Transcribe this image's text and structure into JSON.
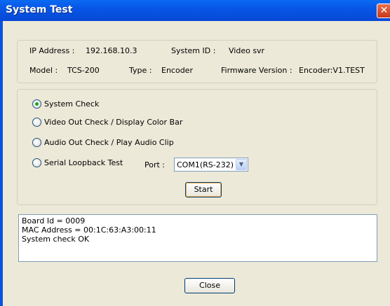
{
  "window": {
    "title": "System Test",
    "close_glyph": "✕"
  },
  "info": {
    "ip_label": "IP Address :",
    "ip_value": "192.168.10.3",
    "sysid_label": "System ID :",
    "sysid_value": "Video svr",
    "model_label": "Model :",
    "model_value": "TCS-200",
    "type_label": "Type :",
    "type_value": "Encoder",
    "fw_label": "Firmware Version :",
    "fw_value": "Encoder:V1.TEST"
  },
  "tests": {
    "options": [
      {
        "label": "System Check",
        "selected": true
      },
      {
        "label": "Video Out Check / Display Color Bar",
        "selected": false
      },
      {
        "label": "Audio Out Check / Play Audio Clip",
        "selected": false
      },
      {
        "label": "Serial Loopback Test",
        "selected": false
      }
    ],
    "port_label": "Port :",
    "port_value": "COM1(RS-232)",
    "start_label": "Start"
  },
  "log": {
    "lines": [
      "Board Id = 0009",
      "MAC Address = 00:1C:63:A3:00:11",
      "System check OK"
    ]
  },
  "footer": {
    "close_label": "Close"
  },
  "icons": {
    "dropdown": "chevron-down-icon"
  },
  "colors": {
    "title_bar": "#0856e6",
    "dialog_bg": "#ece9d8",
    "close_red": "#c8381a"
  }
}
